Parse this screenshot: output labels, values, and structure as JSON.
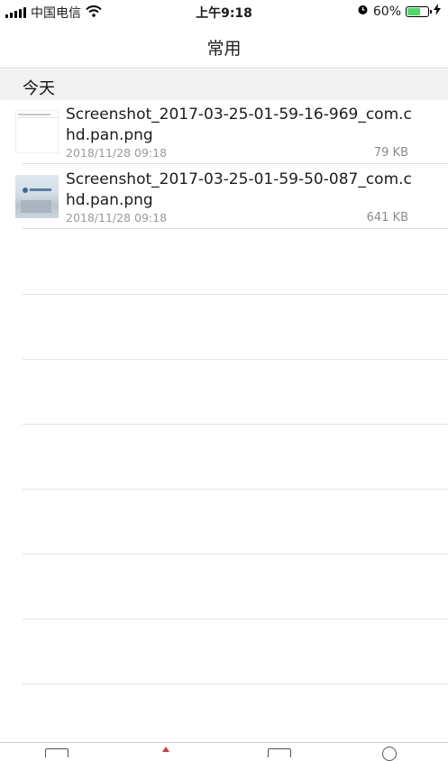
{
  "status_bar": {
    "carrier": "中国电信",
    "time": "上午9:18",
    "battery_percent": "60%",
    "battery_level": 0.6
  },
  "nav": {
    "title": "常用"
  },
  "section": {
    "title": "今天"
  },
  "files": [
    {
      "name": "Screenshot_2017-03-25-01-59-16-969_com.chd.pan.png",
      "date": "2018/11/28 09:18",
      "size": "79 KB"
    },
    {
      "name": "Screenshot_2017-03-25-01-59-50-087_com.chd.pan.png",
      "date": "2018/11/28 09:18",
      "size": "641 KB"
    }
  ],
  "colors": {
    "battery_fill": "#4cd964",
    "section_bg": "#f2f2f2",
    "secondary_text": "#9a9a9a"
  }
}
